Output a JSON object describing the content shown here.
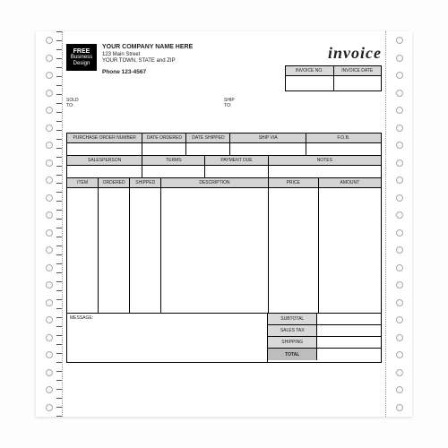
{
  "logo": {
    "line1": "FREE",
    "line2": "Business",
    "line3": "Design"
  },
  "company": {
    "name": "YOUR COMPANY NAME HERE",
    "address": "123 Main Street",
    "citystate": "YOUR TOWN, STATE and ZIP",
    "phone": "Phone 123-4567"
  },
  "title": "invoice",
  "meta": {
    "invoice_no_label": "INVOICE NO.",
    "invoice_date_label": "INVOICE DATE"
  },
  "address_labels": {
    "sold_to": "SOLD\nTO:",
    "ship_to": "SHIP\nTO:"
  },
  "row1_headers": [
    "PURCHASE ORDER NUMBER",
    "DATE ORDERED",
    "DATE SHIPPED",
    "SHIP VIA",
    "F.O.B."
  ],
  "row2_headers": [
    "SALESPERSON",
    "TERMS",
    "PAYMENT DUE",
    "NOTES"
  ],
  "item_headers": [
    "ITEM",
    "ORDERED",
    "SHIPPED",
    "DESCRIPTION",
    "PRICE",
    "AMOUNT"
  ],
  "message_label": "MESSAGE:",
  "totals": {
    "subtotal": "SUBTOTAL",
    "salestax": "SALES TAX",
    "shipping": "SHIPPING",
    "total": "TOTAL"
  }
}
